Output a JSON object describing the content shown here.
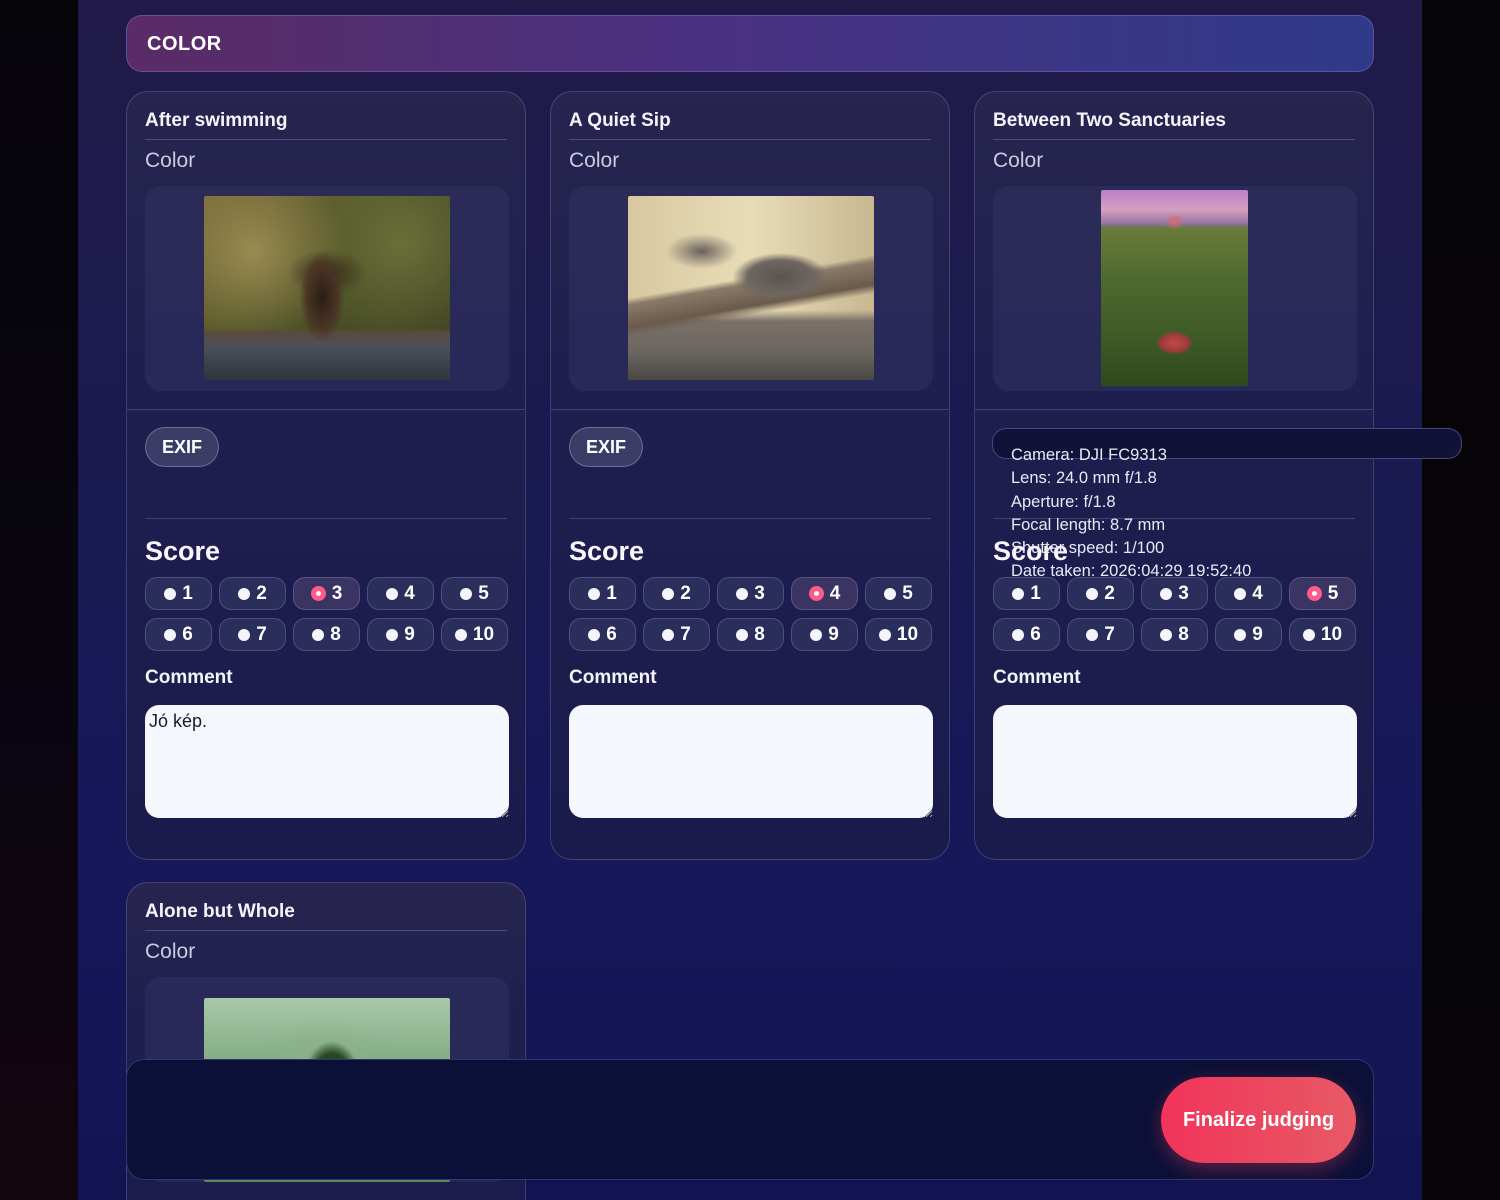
{
  "category": {
    "title": "COLOR"
  },
  "cards": [
    {
      "title": "After swimming",
      "category": "Color",
      "photo": "bird-bathing-photo",
      "exif_label": "EXIF",
      "score_heading": "Score",
      "score_options": [
        "1",
        "2",
        "3",
        "4",
        "5",
        "6",
        "7",
        "8",
        "9",
        "10"
      ],
      "selected_score": "3",
      "comment_label": "Comment",
      "comment_value": "Jó kép."
    },
    {
      "title": "A Quiet Sip",
      "category": "Color",
      "photo": "squirrel-drinking-photo",
      "exif_label": "EXIF",
      "score_heading": "Score",
      "score_options": [
        "1",
        "2",
        "3",
        "4",
        "5",
        "6",
        "7",
        "8",
        "9",
        "10"
      ],
      "selected_score": "4",
      "comment_label": "Comment",
      "comment_value": ""
    },
    {
      "title": "Between Two Sanctuaries",
      "category": "Color",
      "photo": "aerial-hill-sanctuaries-photo",
      "exif_label": "EXIF",
      "score_heading": "Score",
      "score_options": [
        "1",
        "2",
        "3",
        "4",
        "5",
        "6",
        "7",
        "8",
        "9",
        "10"
      ],
      "selected_score": "5",
      "comment_label": "Comment",
      "comment_value": ""
    },
    {
      "title": "Alone but Whole",
      "category": "Color",
      "photo": "lone-tree-island-photo"
    }
  ],
  "exif_popup": {
    "camera": "Camera: DJI FC9313",
    "lens": "Lens: 24.0 mm f/1.8",
    "aperture": "Aperture: f/1.8",
    "focal_length": "Focal length: 8.7 mm",
    "shutter_speed": "Shutter speed: 1/100",
    "date_taken": "Date taken: 2026:04:29 19:52:40"
  },
  "footer": {
    "finalize_label": "Finalize judging"
  },
  "colors": {
    "accent": "#ff5a8a",
    "finalize": "#f2335a",
    "panel": "#1e1e4f"
  }
}
